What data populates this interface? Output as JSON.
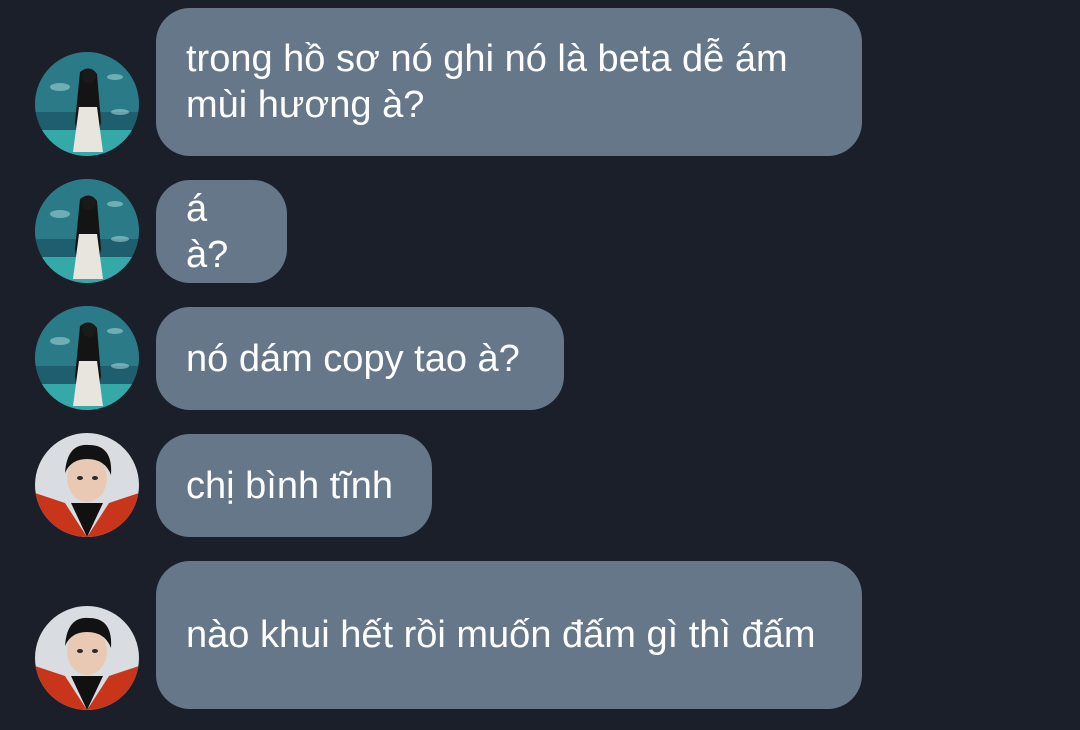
{
  "colors": {
    "background": "#1a1f29",
    "bubble": "#66778a",
    "text": "#ffffff"
  },
  "messages": [
    {
      "sender": "aquarium-avatar",
      "text": "trong hồ sơ nó ghi nó là beta dễ ám mùi hương à?"
    },
    {
      "sender": "aquarium-avatar",
      "text": "á à?"
    },
    {
      "sender": "aquarium-avatar",
      "text": "nó dám copy tao à?"
    },
    {
      "sender": "red-jacket-avatar",
      "text": "chị bình tĩnh"
    },
    {
      "sender": "red-jacket-avatar",
      "text": "nào khui hết rồi muốn đấm gì thì đấm"
    }
  ]
}
